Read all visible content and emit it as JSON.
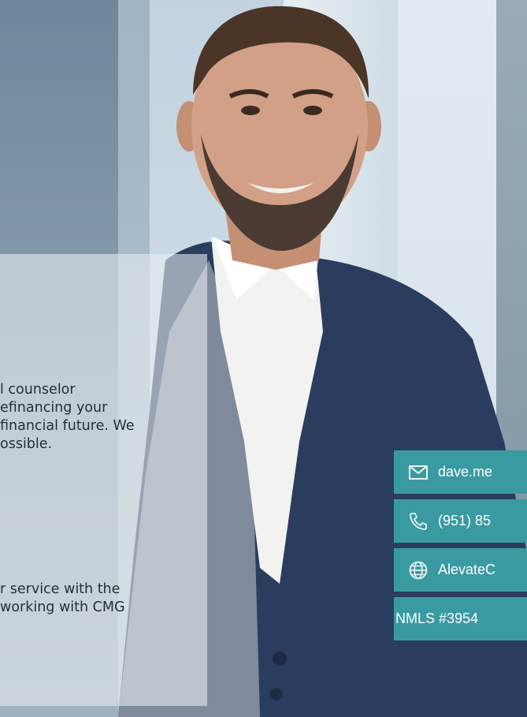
{
  "content": {
    "paragraph_1": [
      "l counselor",
      "efinancing your",
      "financial future. We",
      "ossible."
    ],
    "paragraph_2": [
      "r service with the",
      "working with CMG"
    ]
  },
  "contacts": {
    "email": {
      "text": "dave.me",
      "icon": "mail-icon"
    },
    "phone": {
      "text": "(951) 85",
      "icon": "phone-icon"
    },
    "website": {
      "text": "AlevateC",
      "icon": "globe-icon"
    },
    "nmls": {
      "text": "NMLS #3954"
    }
  },
  "colors": {
    "tile": "#3a9aa2",
    "text": "#1f2e39",
    "panel": "rgba(232,238,242,0.58)"
  }
}
